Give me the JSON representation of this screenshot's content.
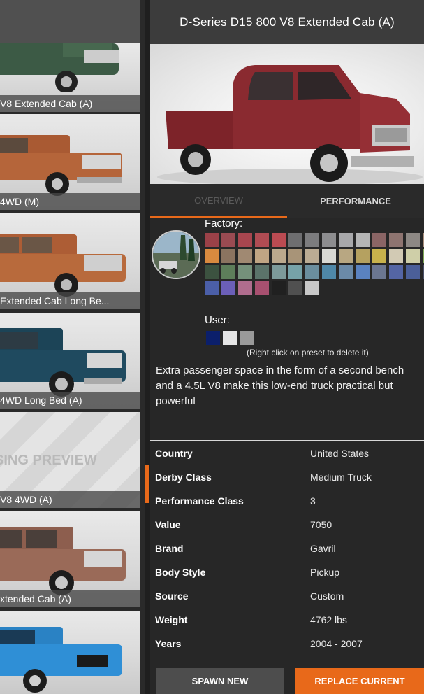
{
  "window": {
    "title": "D-Series D15 800 V8 Extended Cab (A)"
  },
  "tabs": {
    "overview": "OVERVIEW",
    "performance": "PERFORMANCE"
  },
  "thumbnails": [
    {
      "caption": "V8 Extended Cab (A)",
      "color": "#3c5a45"
    },
    {
      "caption": "4WD (M)",
      "color": "#b5653a"
    },
    {
      "caption": "Extended Cab Long Be...",
      "color": "#b86a3c"
    },
    {
      "caption": "4WD Long Bed (A)",
      "color": "#1f4a5f"
    },
    {
      "caption": "V8 4WD (A)",
      "missing_text": "SING PREVIEW"
    },
    {
      "caption": "xtended Cab (A)",
      "color": "#9a6a58"
    },
    {
      "caption": "",
      "color": "#2f8fd6"
    }
  ],
  "colors": {
    "factory_label": "Factory:",
    "user_label": "User:",
    "hint": "(Right click on preset to delete it)",
    "factory": [
      "#9b4148",
      "#9a4b52",
      "#a8464f",
      "#b04c53",
      "#bb4b52",
      "#6e6e70",
      "#7c7c7e",
      "#8d8d8f",
      "#a8a8aa",
      "#b5b5b5",
      "#8b6565",
      "#8e7470",
      "#8d8884",
      "#a88e7c",
      "#d98a3f",
      "#8b7460",
      "#a08972",
      "#c0a584",
      "#bca98d",
      "#a89478",
      "#bbac94",
      "#d9d9d4",
      "#b8a782",
      "#b5a160",
      "#c8b24c",
      "#d2cab4",
      "#cfcfa8",
      "#7ea655",
      "#3c5240",
      "#5d7e5a",
      "#75917b",
      "#5b736a",
      "#7d9a9a",
      "#76a2a8",
      "#6b8e9e",
      "#4f88a8",
      "#6b8aa8",
      "#5a82c0",
      "#6b7690",
      "#5465a4",
      "#4b5f98",
      "#4a5066",
      "#4b5fa8",
      "#6b5fb8",
      "#b06d8e",
      "#a85070",
      "#202020",
      "#505050",
      "#c8c8c8"
    ],
    "user": [
      "#0b1f6b",
      "#e6e6e6",
      "#9a9a9a"
    ]
  },
  "description": "Extra passenger space in the form of a second bench and a 4.5L V8 make this low-end truck practical but powerful",
  "specs": [
    {
      "key": "Country",
      "value": "United States"
    },
    {
      "key": "Derby Class",
      "value": "Medium Truck"
    },
    {
      "key": "Performance Class",
      "value": "3"
    },
    {
      "key": "Value",
      "value": "7050"
    },
    {
      "key": "Brand",
      "value": "Gavril"
    },
    {
      "key": "Body Style",
      "value": "Pickup"
    },
    {
      "key": "Source",
      "value": "Custom"
    },
    {
      "key": "Weight",
      "value": "4762 lbs"
    },
    {
      "key": "Years",
      "value": "2004 - 2007"
    }
  ],
  "buttons": {
    "spawn": "SPAWN NEW",
    "replace": "REPLACE CURRENT"
  },
  "accent": "#e8691a",
  "preview_color": "#8a2a30"
}
